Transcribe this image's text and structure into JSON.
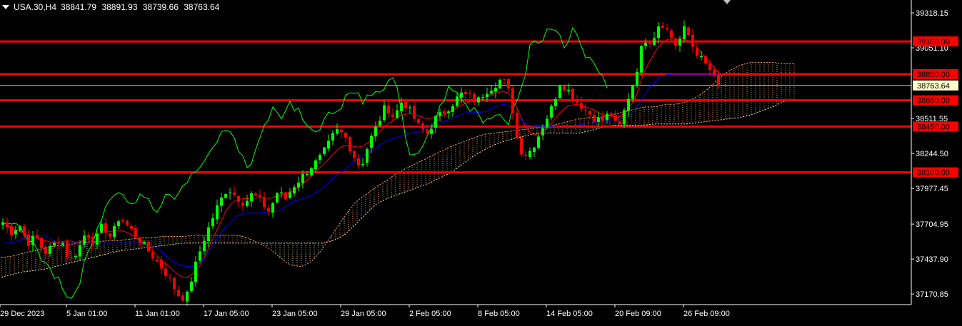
{
  "header": {
    "symbol": "USA.30,H4",
    "open": "38841.79",
    "high": "38891.93",
    "low": "38739.66",
    "close": "38763.64"
  },
  "colors": {
    "background": "#000000",
    "bull_candle": "#00ff00",
    "bear_candle": "#ff0000",
    "level_line": "#ff0000",
    "tenkan": "#ff0000",
    "kijun": "#0000ff",
    "chikou": "#00ff00",
    "cloud_a": "#f4a460",
    "cloud_b": "#f5deb3",
    "axis": "#ffffff",
    "price_tag": "#ffffcc"
  },
  "chart_data": {
    "type": "candlestick",
    "ylim": [
      37090,
      39400
    ],
    "y_ticks": [
      "39318.15",
      "39051.10",
      "38511.55",
      "38244.50",
      "37977.45",
      "37704.95",
      "37437.90",
      "37170.85"
    ],
    "x_ticks": [
      "29 Dec 2023",
      "5 Jan 01:00",
      "11 Jan 01:00",
      "17 Jan 05:00",
      "23 Jan 05:00",
      "29 Jan 05:00",
      "2 Feb 05:00",
      "8 Feb 05:00",
      "14 Feb 05:00",
      "20 Feb 09:00",
      "26 Feb 09:00"
    ],
    "levels": [
      {
        "label": "39100.00",
        "value": 39100
      },
      {
        "label": "38850.00",
        "value": 38850
      },
      {
        "label": "38650.00",
        "value": 38650
      },
      {
        "label": "38450.00",
        "value": 38450
      },
      {
        "label": "38100.00",
        "value": 38100
      }
    ],
    "current_price": {
      "label": "38763.64",
      "value": 38763.64
    },
    "close_path": [
      37720,
      37640,
      37700,
      37560,
      37610,
      37480,
      37540,
      37600,
      37420,
      37500,
      37650,
      37560,
      37700,
      37600,
      37760,
      37690,
      37620,
      37540,
      37460,
      37380,
      37290,
      37170,
      37130,
      37360,
      37560,
      37720,
      37870,
      37980,
      37920,
      37860,
      37940,
      37880,
      37800,
      37950,
      37900,
      38000,
      38070,
      38140,
      38200,
      38300,
      38420,
      38390,
      38250,
      38130,
      38330,
      38460,
      38610,
      38520,
      38650,
      38560,
      38450,
      38400,
      38510,
      38560,
      38620,
      38700,
      38680,
      38640,
      38720,
      38760,
      38820,
      38690,
      38280,
      38230,
      38330,
      38470,
      38600,
      38790,
      38720,
      38640,
      38580,
      38520,
      38490,
      38560,
      38420,
      38640,
      38830,
      39120,
      39100,
      39260,
      39170,
      39060,
      39210,
      39050,
      38960,
      38880,
      38740
    ],
    "tenkan_path": [
      37700,
      37680,
      37650,
      37620,
      37600,
      37580,
      37560,
      37570,
      37580,
      37560,
      37590,
      37610,
      37640,
      37650,
      37660,
      37640,
      37600,
      37560,
      37500,
      37430,
      37380,
      37320,
      37290,
      37330,
      37420,
      37560,
      37700,
      37830,
      37890,
      37900,
      37900,
      37910,
      37900,
      37920,
      37940,
      37960,
      38010,
      38070,
      38130,
      38190,
      38260,
      38310,
      38300,
      38290,
      38330,
      38390,
      38460,
      38500,
      38540,
      38550,
      38530,
      38510,
      38520,
      38540,
      38570,
      38610,
      38640,
      38650,
      38670,
      38700,
      38720,
      38700,
      38560,
      38420,
      38380,
      38420,
      38480,
      38560,
      38610,
      38620,
      38600,
      38580,
      38540,
      38530,
      38520,
      38570,
      38660,
      38860,
      38980,
      39080,
      39120,
      39120,
      39120,
      39080,
      39010,
      38940,
      38860
    ],
    "kijun_path": [
      37560,
      37560,
      37580,
      37620,
      37620,
      37620,
      37580,
      37560,
      37560,
      37560,
      37560,
      37560,
      37560,
      37560,
      37560,
      37560,
      37560,
      37560,
      37540,
      37500,
      37440,
      37400,
      37380,
      37380,
      37420,
      37520,
      37620,
      37700,
      37760,
      37790,
      37790,
      37790,
      37800,
      37800,
      37840,
      37880,
      37900,
      37920,
      37960,
      38010,
      38080,
      38110,
      38180,
      38220,
      38250,
      38290,
      38340,
      38360,
      38380,
      38400,
      38410,
      38440,
      38460,
      38490,
      38510,
      38540,
      38560,
      38560,
      38560,
      38600,
      38620,
      38610,
      38520,
      38460,
      38450,
      38450,
      38450,
      38460,
      38460,
      38460,
      38470,
      38480,
      38490,
      38500,
      38510,
      38530,
      38580,
      38680,
      38770,
      38830,
      38850,
      38850,
      38850,
      38850,
      38850,
      38850,
      38850
    ],
    "span_a": [
      37450,
      37460,
      37480,
      37500,
      37520,
      37540,
      37540,
      37560,
      37570,
      37570,
      37580,
      37580,
      37590,
      37600,
      37600,
      37610,
      37610,
      37610,
      37620,
      37620,
      37620,
      37620,
      37620,
      37600,
      37560,
      37520,
      37450,
      37390,
      37380,
      37420,
      37520,
      37640,
      37760,
      37870,
      37930,
      37990,
      38040,
      38100,
      38140,
      38180,
      38220,
      38260,
      38300,
      38330,
      38360,
      38390,
      38400,
      38410,
      38420,
      38430,
      38440,
      38450,
      38470,
      38490,
      38510,
      38520,
      38520,
      38540,
      38560,
      38580,
      38600,
      38600,
      38620,
      38620,
      38640,
      38680,
      38740,
      38820,
      38880,
      38920,
      38940,
      38940,
      38940,
      38930,
      38930
    ],
    "span_b": [
      37300,
      37320,
      37340,
      37350,
      37360,
      37380,
      37400,
      37420,
      37440,
      37460,
      37480,
      37500,
      37510,
      37520,
      37530,
      37540,
      37550,
      37560,
      37560,
      37560,
      37560,
      37560,
      37560,
      37560,
      37560,
      37560,
      37560,
      37560,
      37560,
      37560,
      37560,
      37580,
      37620,
      37700,
      37780,
      37860,
      37900,
      37930,
      37960,
      37990,
      38020,
      38060,
      38100,
      38160,
      38220,
      38270,
      38310,
      38340,
      38360,
      38380,
      38400,
      38400,
      38400,
      38400,
      38400,
      38420,
      38440,
      38460,
      38460,
      38460,
      38460,
      38470,
      38470,
      38470,
      38470,
      38480,
      38490,
      38500,
      38510,
      38520,
      38540,
      38570,
      38600,
      38640,
      38660
    ]
  }
}
